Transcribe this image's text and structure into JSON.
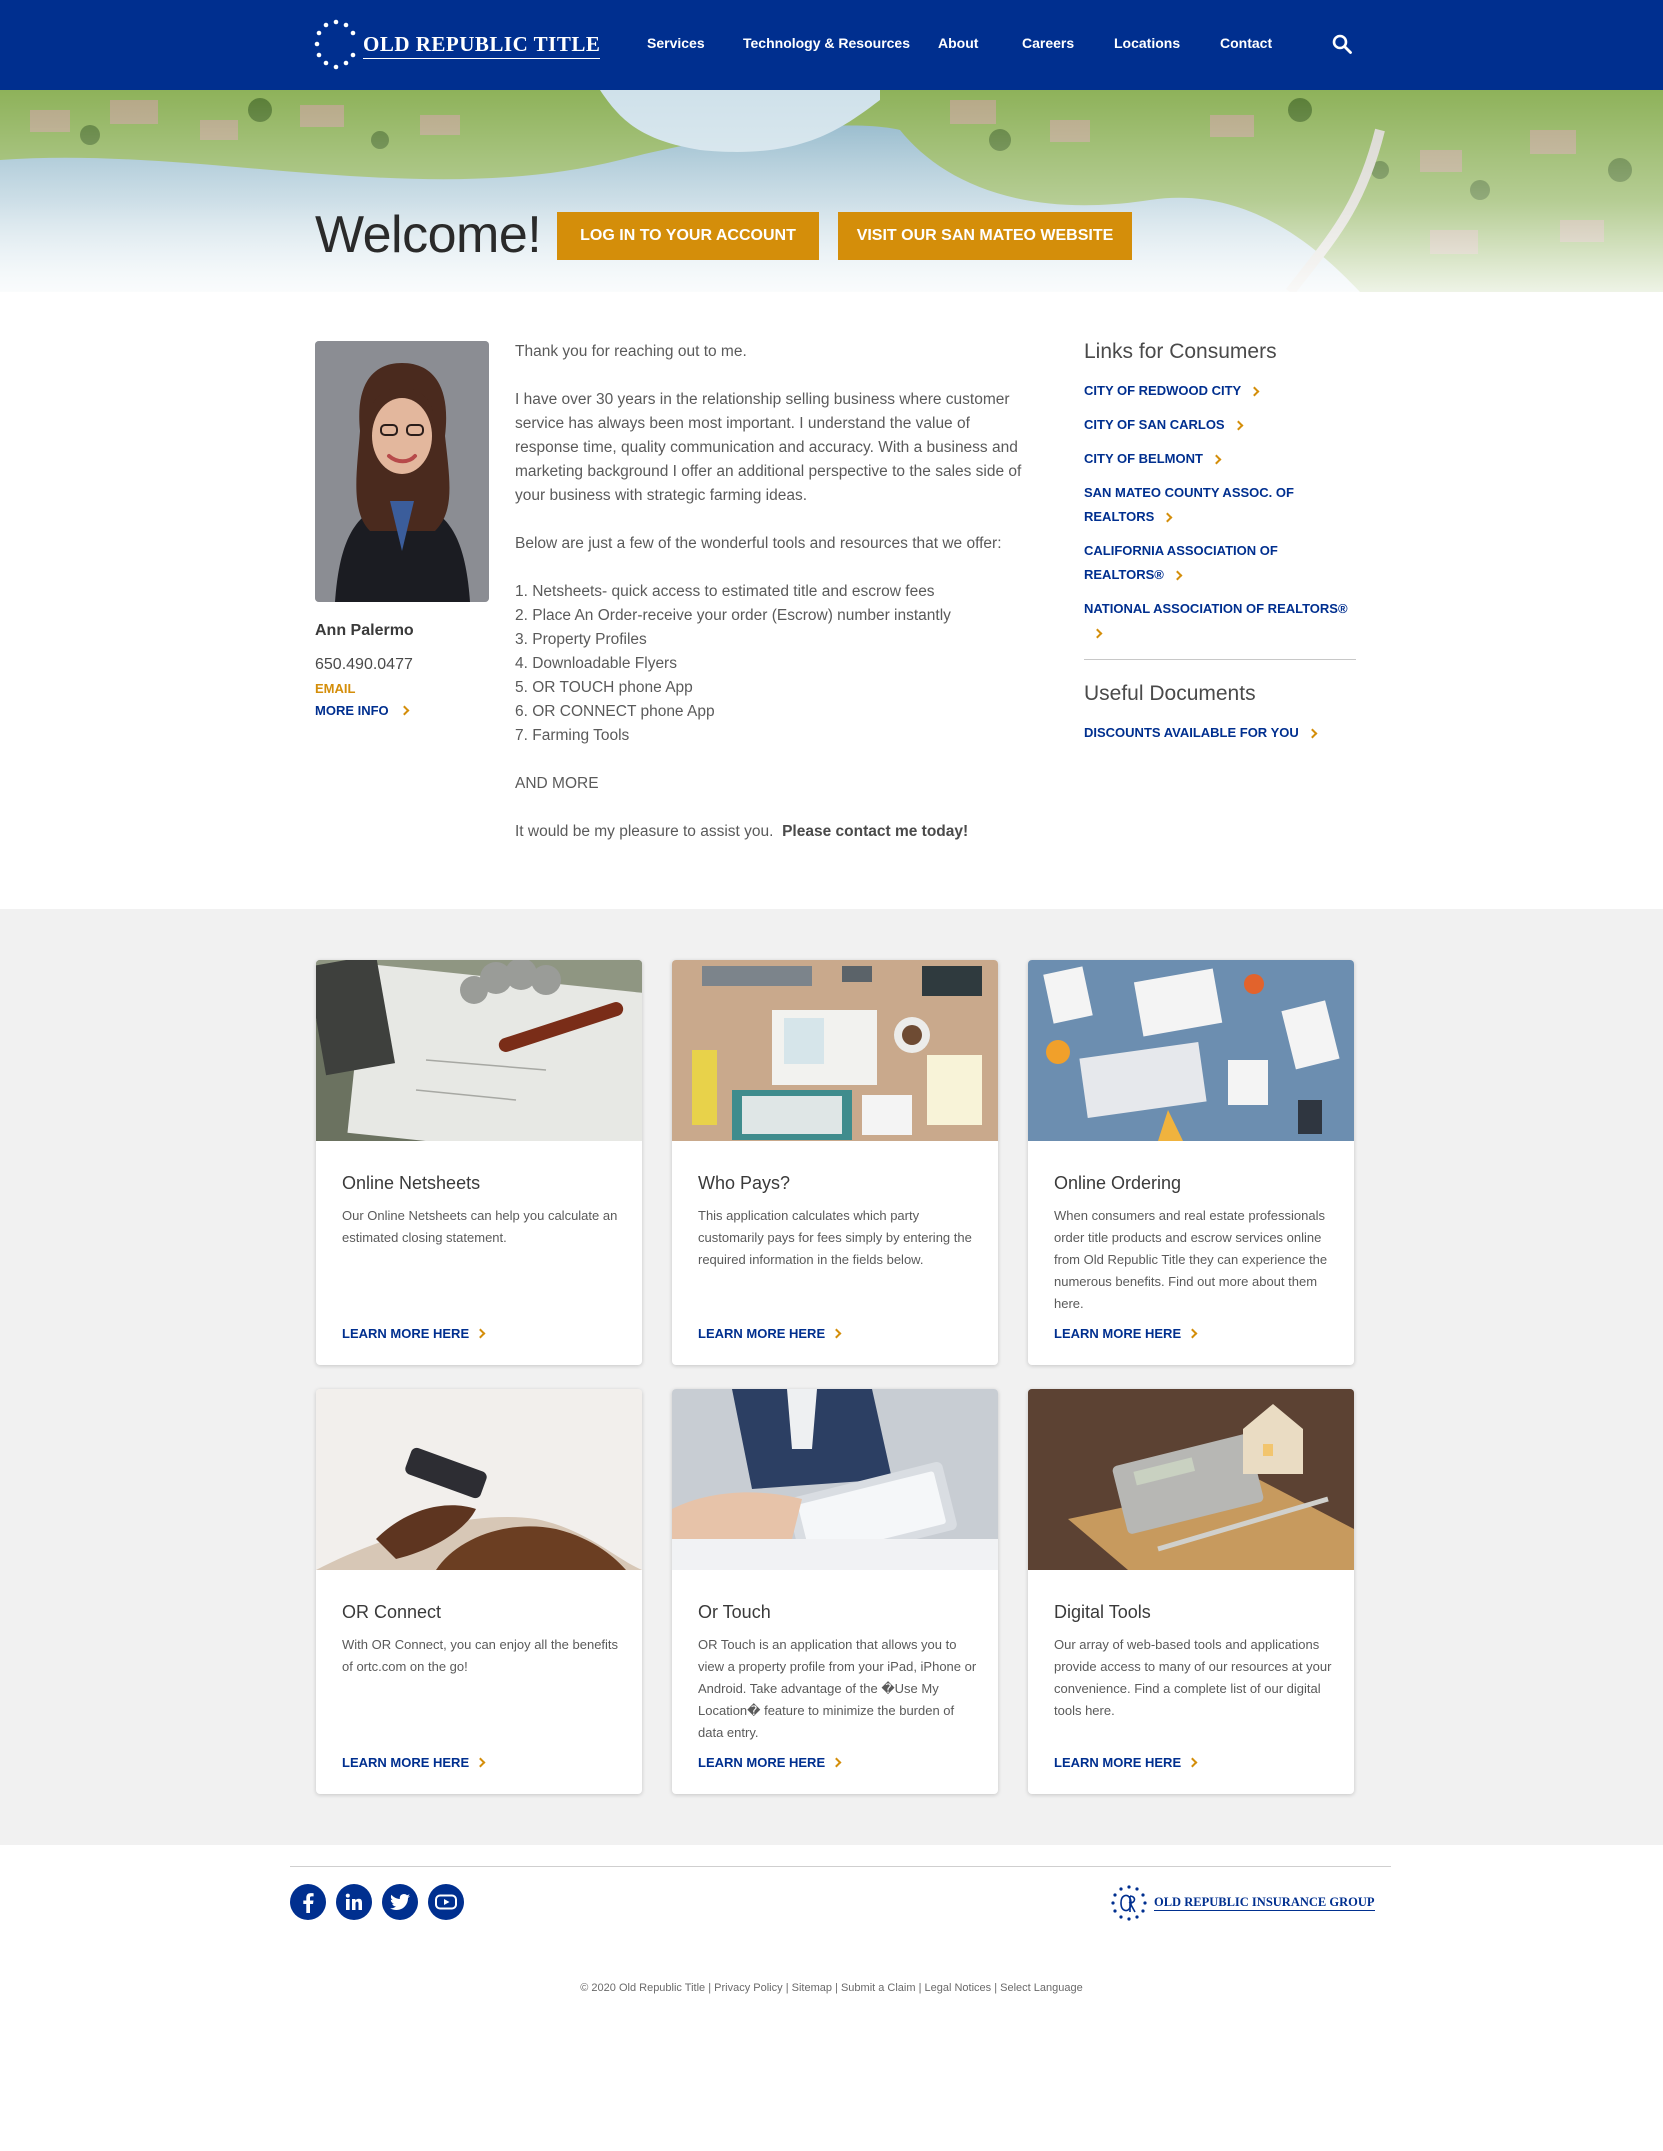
{
  "header": {
    "logo_text": "OLD REPUBLIC TITLE",
    "nav": [
      {
        "label": "Services"
      },
      {
        "label": "Technology & Resources"
      },
      {
        "label": "About"
      },
      {
        "label": "Careers"
      },
      {
        "label": "Locations"
      },
      {
        "label": "Contact"
      }
    ],
    "search_icon": "search-icon"
  },
  "hero": {
    "welcome": "Welcome!",
    "login_button": "LOG IN TO YOUR ACCOUNT",
    "site_button": "VISIT OUR SAN MATEO WEBSITE"
  },
  "agent": {
    "name": "Ann Palermo",
    "phone": "650.490.0477",
    "email_label": "EMAIL",
    "more_info_label": "MORE INFO"
  },
  "bio": {
    "p1": "Thank you for reaching out to me.",
    "p2": "I have over 30 years in the relationship selling business where customer service has always been most important. I understand the value of response time, quality communication and accuracy.  With a business and marketing background I offer an additional perspective to the sales side of your business with strategic farming ideas.",
    "p3": "Below are just a few of the wonderful tools and resources that we offer:",
    "list": [
      "1. Netsheets- quick access to estimated title and escrow fees",
      "2. Place An Order-receive your order (Escrow) number instantly",
      "3. Property Profiles",
      "4. Downloadable Flyers",
      "5. OR TOUCH phone App",
      "6. OR CONNECT phone App",
      "7. Farming Tools"
    ],
    "and_more": "AND MORE",
    "closing": "It would be my pleasure to assist you.",
    "closing_bold": "Please contact me today!"
  },
  "sidebar": {
    "consumers_title": "Links for Consumers",
    "consumer_links": [
      "CITY OF REDWOOD CITY",
      "CITY OF SAN CARLOS",
      "CITY OF BELMONT",
      "SAN MATEO COUNTY ASSOC. OF REALTORS",
      "CALIFORNIA ASSOCIATION OF REALTORS®",
      "NATIONAL ASSOCIATION OF REALTORS®"
    ],
    "documents_title": "Useful Documents",
    "document_links": [
      "DISCOUNTS AVAILABLE FOR YOU"
    ]
  },
  "cards": [
    {
      "title": "Online Netsheets",
      "text": "Our Online Netsheets can help you calculate an estimated closing statement.",
      "link": "LEARN MORE HERE"
    },
    {
      "title": "Who Pays?",
      "text": "This application calculates which party customarily pays for fees simply by entering the required information in the fields below.",
      "link": "LEARN MORE HERE"
    },
    {
      "title": "Online Ordering",
      "text": "When consumers and real estate professionals order title products and escrow services online from Old Republic Title they can experience the numerous benefits. Find out more about them here.",
      "link": "LEARN MORE HERE"
    },
    {
      "title": "OR Connect",
      "text": "With OR Connect, you can enjoy all the benefits of ortc.com on the go!",
      "link": "LEARN MORE HERE"
    },
    {
      "title": "Or Touch",
      "text": "OR Touch is an application that allows you to view a property profile from your iPad, iPhone or Android. Take advantage of the �Use My Location� feature to minimize the burden of data entry.",
      "link": "LEARN MORE HERE"
    },
    {
      "title": "Digital Tools",
      "text": "Our array of web-based tools and applications provide access to many of our resources at your convenience. Find a complete list of our digital tools here.",
      "link": "LEARN MORE HERE"
    }
  ],
  "footer": {
    "social_icons": [
      "facebook-icon",
      "linkedin-icon",
      "twitter-icon",
      "youtube-icon"
    ],
    "group_name": "OLD REPUBLIC INSURANCE GROUP",
    "links": [
      "© 2020 Old Republic Title",
      "Privacy Policy",
      "Sitemap",
      "Submit a Claim",
      "Legal Notices",
      "Select Language"
    ],
    "separator": "|"
  },
  "colors": {
    "brand_blue": "#002f8f",
    "accent_gold": "#d48e0a",
    "section_gray": "#f1f1f1"
  }
}
